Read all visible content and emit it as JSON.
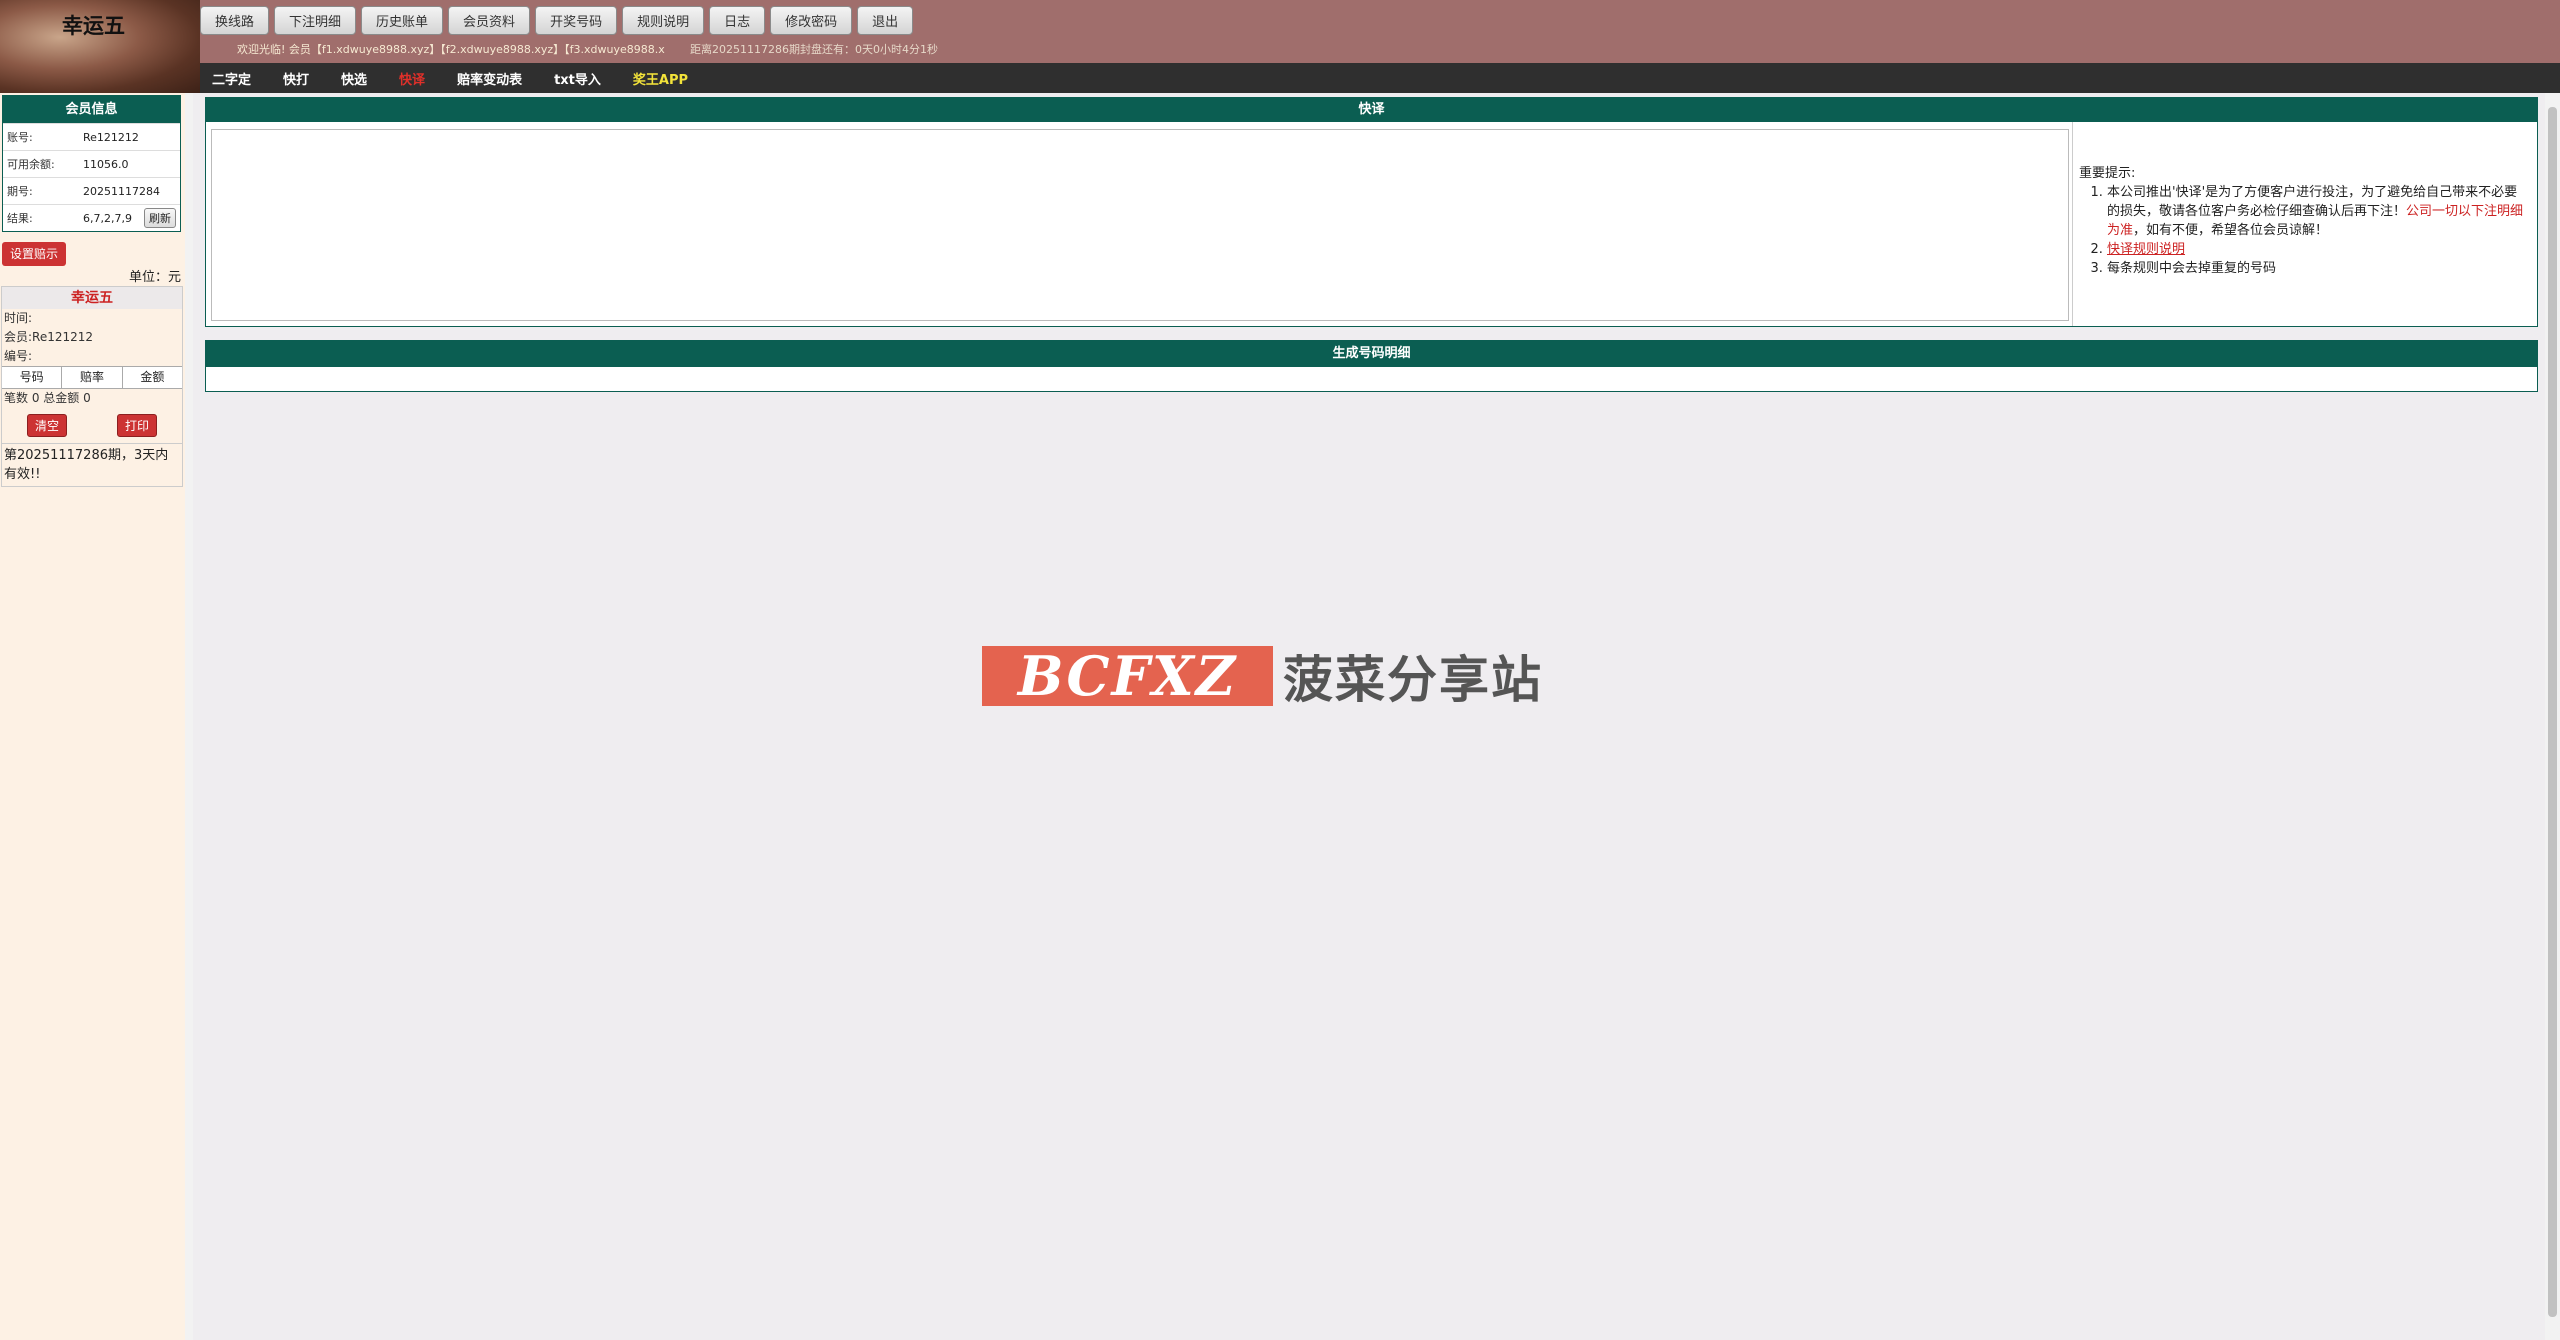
{
  "header": {
    "logo_text": "幸运五",
    "nav": [
      "换线路",
      "下注明细",
      "历史账单",
      "会员资料",
      "开奖号码",
      "规则说明",
      "日志",
      "修改密码",
      "退出"
    ],
    "welcome": "欢迎光临! 会员【f1.xdwuye8988.xyz】【f2.xdwuye8988.xyz】【f3.xdwuye8988.x",
    "countdown": "距离20251117286期封盘还有：0天0小时4分1秒"
  },
  "subnav": [
    "二字定",
    "快打",
    "快选",
    "快译",
    "赔率变动表",
    "txt导入",
    "奖王APP"
  ],
  "member": {
    "title": "会员信息",
    "rows": [
      {
        "k": "账号:",
        "v": "Re121212"
      },
      {
        "k": "可用余额:",
        "v": "11056.0"
      },
      {
        "k": "期号:",
        "v": "20251117284"
      },
      {
        "k": "结果:",
        "v": "6,7,2,7,9"
      }
    ],
    "refresh": "刷新",
    "settings": "设置赔示",
    "unit": "单位：元"
  },
  "ticket": {
    "title": "幸运五",
    "time": "时间:",
    "member": "会员:Re121212",
    "serial": "编号:",
    "cols": [
      "号码",
      "赔率",
      "金额"
    ],
    "summary": "笔数 0 总金额 0",
    "clear": "清空",
    "print": "打印",
    "note": "第20251117286期，3天内有效!!"
  },
  "main": {
    "panel1_title": "快译",
    "tips_title": "重要提示:",
    "tip1a": "本公司推出'快译'是为了方便客户进行投注，为了避免给自己带来不必要的损失，敬请各位客户务必检仔细查确认后再下注！",
    "tip1b": "公司一切以下注明细为准",
    "tip1c": "，如有不便，希望各位会员谅解！",
    "tip2": "快译规则说明",
    "tip3": "每条规则中会去掉重复的号码",
    "panel2_title": "生成号码明细"
  },
  "watermark": {
    "logo": "BCFXZ",
    "text": "菠菜分享站"
  }
}
